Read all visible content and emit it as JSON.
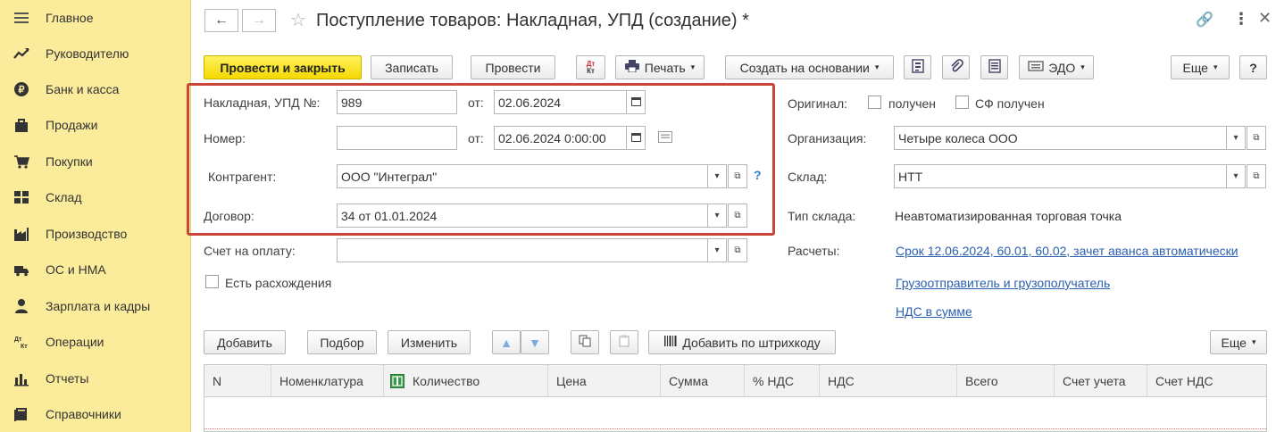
{
  "sidebar": {
    "items": [
      {
        "label": "Главное",
        "icon": "menu-icon"
      },
      {
        "label": "Руководителю",
        "icon": "trend-icon"
      },
      {
        "label": "Банк и касса",
        "icon": "coin-icon"
      },
      {
        "label": "Продажи",
        "icon": "bag-icon"
      },
      {
        "label": "Покупки",
        "icon": "cart-icon"
      },
      {
        "label": "Склад",
        "icon": "warehouse-icon"
      },
      {
        "label": "Производство",
        "icon": "factory-icon"
      },
      {
        "label": "ОС и НМА",
        "icon": "truck-icon"
      },
      {
        "label": "Зарплата и кадры",
        "icon": "person-icon"
      },
      {
        "label": "Операции",
        "icon": "dt-kt-icon"
      },
      {
        "label": "Отчеты",
        "icon": "bar-chart-icon"
      },
      {
        "label": "Справочники",
        "icon": "book-icon"
      }
    ]
  },
  "header": {
    "title": "Поступление товаров: Накладная, УПД (создание) *"
  },
  "toolbar": {
    "post_close": "Провести и закрыть",
    "save": "Записать",
    "post": "Провести",
    "dtkt_top": "Дт",
    "dtkt_bottom": "Кт",
    "print": "Печать",
    "create_based": "Создать на основании",
    "edo": "ЭДО",
    "more": "Еще",
    "help": "?"
  },
  "form": {
    "invoice_label": "Накладная, УПД №:",
    "invoice_value": "989",
    "from_label": "от:",
    "invoice_date": "02.06.2024",
    "number_label": "Номер:",
    "number_value": "",
    "number_date": "02.06.2024  0:00:00",
    "counterparty_label": "Контрагент:",
    "counterparty_value": "ООО \"Интеграл\"",
    "contract_label": "Договор:",
    "contract_value": "34 от 01.01.2024",
    "payment_label": "Счет на оплату:",
    "payment_value": "",
    "discrepancy_label": "Есть расхождения",
    "original_label": "Оригинал:",
    "received_label": "получен",
    "sf_received_label": "СФ получен",
    "org_label": "Организация:",
    "org_value": "Четыре колеса ООО",
    "warehouse_label": "Склад:",
    "warehouse_value": "НТТ",
    "warehouse_type_label": "Тип склада:",
    "warehouse_type_value": "Неавтоматизированная торговая точка",
    "settlements_label": "Расчеты:",
    "settlements_link": "Срок 12.06.2024, 60.01, 60.02, зачет аванса автоматически",
    "shipper_link": "Грузоотправитель и грузополучатель",
    "vat_link": "НДС в сумме"
  },
  "table_toolbar": {
    "add": "Добавить",
    "pick": "Подбор",
    "change": "Изменить",
    "barcode": "Добавить по штрихкоду",
    "more": "Еще"
  },
  "table": {
    "columns": [
      "N",
      "Номенклатура",
      "Количество",
      "Цена",
      "Сумма",
      "% НДС",
      "НДС",
      "Всего",
      "Счет учета",
      "Счет НДС"
    ]
  },
  "colors": {
    "sidebar_bg": "#fbec9b",
    "primary_button": "#f5d900",
    "highlight_border": "#c9453a",
    "link": "#2a5fb0"
  }
}
